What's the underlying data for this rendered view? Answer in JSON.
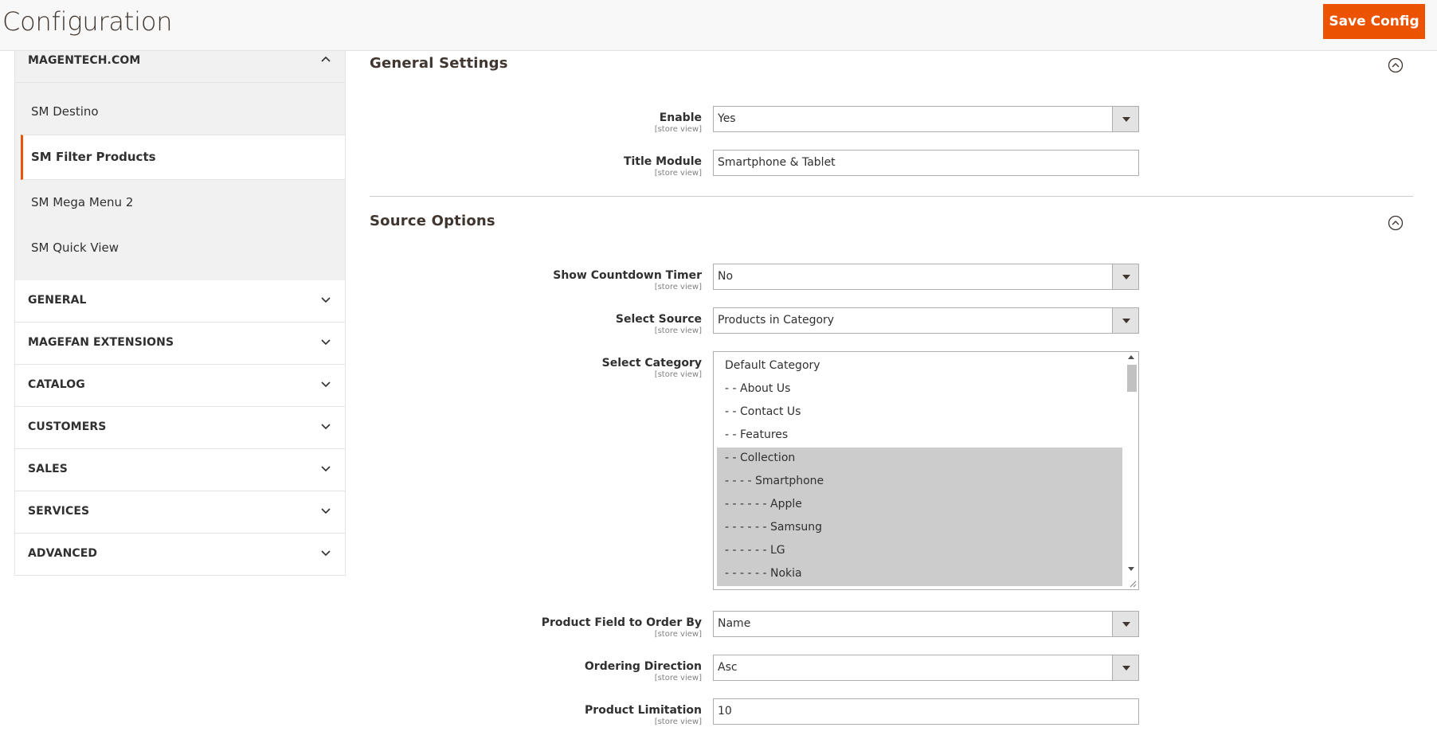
{
  "header": {
    "title": "Configuration",
    "save_label": "Save Config"
  },
  "colors": {
    "accent": "#eb5202",
    "selected_option_bg": "#cccccc"
  },
  "sidebar": {
    "open_section": {
      "label": "MAGENTECH.COM",
      "icon": "chevron-up-icon",
      "items": [
        {
          "label": "SM Destino",
          "active": false
        },
        {
          "label": "SM Filter Products",
          "active": true
        },
        {
          "label": "SM Mega Menu 2",
          "active": false
        },
        {
          "label": "SM Quick View",
          "active": false
        }
      ]
    },
    "sections": [
      {
        "label": "GENERAL",
        "icon": "chevron-down-icon"
      },
      {
        "label": "MAGEFAN EXTENSIONS",
        "icon": "chevron-down-icon"
      },
      {
        "label": "CATALOG",
        "icon": "chevron-down-icon"
      },
      {
        "label": "CUSTOMERS",
        "icon": "chevron-down-icon"
      },
      {
        "label": "SALES",
        "icon": "chevron-down-icon"
      },
      {
        "label": "SERVICES",
        "icon": "chevron-down-icon"
      },
      {
        "label": "ADVANCED",
        "icon": "chevron-down-icon"
      }
    ]
  },
  "general_settings": {
    "title": "General Settings",
    "fields": {
      "enable": {
        "label": "Enable",
        "scope": "[store view]",
        "value": "Yes"
      },
      "title_module": {
        "label": "Title Module",
        "scope": "[store view]",
        "value": "Smartphone & Tablet"
      }
    }
  },
  "source_options": {
    "title": "Source Options",
    "fields": {
      "show_countdown_timer": {
        "label": "Show Countdown Timer",
        "scope": "[store view]",
        "value": "No"
      },
      "select_source": {
        "label": "Select Source",
        "scope": "[store view]",
        "value": "Products in Category"
      },
      "select_category": {
        "label": "Select Category",
        "scope": "[store view]",
        "options": [
          {
            "text": "Default Category",
            "selected": false
          },
          {
            "text": "- - About Us",
            "selected": false
          },
          {
            "text": "- - Contact Us",
            "selected": false
          },
          {
            "text": "- - Features",
            "selected": false
          },
          {
            "text": "- - Collection",
            "selected": true
          },
          {
            "text": "- - - - Smartphone",
            "selected": true
          },
          {
            "text": "- - - - - - Apple",
            "selected": true
          },
          {
            "text": "- - - - - - Samsung",
            "selected": true
          },
          {
            "text": "- - - - - - LG",
            "selected": true
          },
          {
            "text": "- - - - - - Nokia",
            "selected": true
          }
        ]
      },
      "order_by": {
        "label": "Product Field to Order By",
        "scope": "[store view]",
        "value": "Name"
      },
      "ordering_direction": {
        "label": "Ordering Direction",
        "scope": "[store view]",
        "value": "Asc"
      },
      "product_limitation": {
        "label": "Product Limitation",
        "scope": "[store view]",
        "value": "10"
      }
    }
  }
}
